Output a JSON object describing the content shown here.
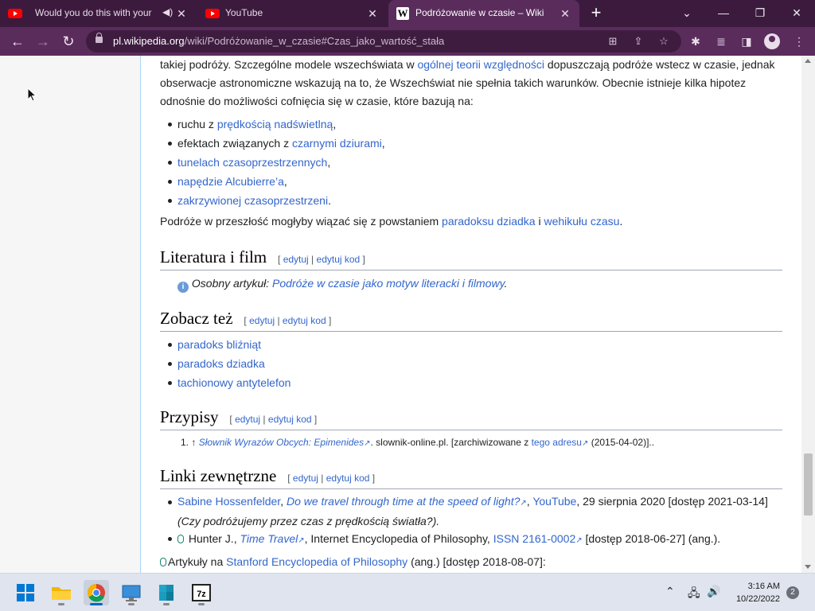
{
  "browser": {
    "tabs": [
      {
        "title": "Would you do this with your",
        "icon": "youtube-icon",
        "audio": true,
        "active": false
      },
      {
        "title": "YouTube",
        "icon": "youtube-icon",
        "audio": false,
        "active": false
      },
      {
        "title": "Podróżowanie w czasie – Wikipe",
        "icon": "wikipedia-icon",
        "active": true
      }
    ],
    "url_host": "pl.wikipedia.org",
    "url_path": "/wiki/Podróżowanie_w_czasie#Czas_jako_wartość_stała",
    "accent": "#5a2c5c"
  },
  "article": {
    "intro_p1": "takiej podróży. Szczególne modele wszechświata w ",
    "intro_link": "ogólnej teorii względności",
    "intro_p2": " dopuszczają podróże wstecz w czasie, jednak obserwacje astronomiczne wskazują na to, że Wszechświat nie spełnia takich warunków. Obecnie istnieje kilka hipotez odnośnie do możliwości cofnięcia się w czasie, które bazują na:",
    "hypotheses": [
      {
        "pre": "ruchu z ",
        "link": "prędkością nadświetlną",
        "post": ","
      },
      {
        "pre": "efektach związanych z ",
        "link": "czarnymi dziurami",
        "post": ","
      },
      {
        "pre": "",
        "link": "tunelach czasoprzestrzennych",
        "post": ","
      },
      {
        "pre": "",
        "link": "napędzie Alcubierre’a",
        "post": ","
      },
      {
        "pre": "",
        "link": "zakrzywionej czasoprzestrzeni",
        "post": "."
      }
    ],
    "future_pre": "Podróże w przeszłość mogłyby wiązać się z powstaniem ",
    "future_link1": "paradoksu dziadka",
    "future_mid": " i ",
    "future_link2": "wehikułu czasu",
    "future_post": ".",
    "edit_open": "[ ",
    "edit_label": "edytuj",
    "edit_sep": " | ",
    "edit_code_label": "edytuj kod",
    "edit_close": " ]",
    "sections": {
      "literatura": "Literatura i film",
      "zobacz": "Zobacz też",
      "przypisy": "Przypisy",
      "linki": "Linki zewnętrzne"
    },
    "main_article_label": "Osobny artykuł: ",
    "main_article_link": "Podróże w czasie jako motyw literacki i filmowy",
    "main_article_post": ".",
    "see_also": [
      "paradoks bliźniąt",
      "paradoks dziadka",
      "tachionowy antytelefon"
    ],
    "ref": {
      "num": "1. ↑ ",
      "title": "Słownik Wyrazów Obcych: Epimenides",
      "source": ". slownik-online.pl. [zarchiwizowane z ",
      "archive_link": "tego adresu",
      "date": " (2015-04-02)].."
    },
    "ext1": {
      "author": "Sabine Hossenfelder",
      "comma": ", ",
      "title": "Do we travel through time at the speed of light?",
      "site": "YouTube",
      "date": ", 29 sierpnia 2020 [dostęp 2021-03-14]",
      "translation": "(Czy podróżujemy przez czas z prędkością światła?)."
    },
    "ext2": {
      "author": "Hunter J.",
      "title": "Time Travel",
      "mid": ", Internet Encyclopedia of Philosophy, ",
      "issn": "ISSN 2161-0002",
      "date": " [dostęp 2018-06-27] (ang.)."
    },
    "ext3": {
      "pre": "Artykuły na ",
      "link": "Stanford Encyclopedia of Philosophy",
      "post": " (ang.) [dostęp 2018-08-07]:"
    }
  },
  "taskbar": {
    "time": "3:16 AM",
    "date": "10/22/2022",
    "notifications": "2"
  }
}
